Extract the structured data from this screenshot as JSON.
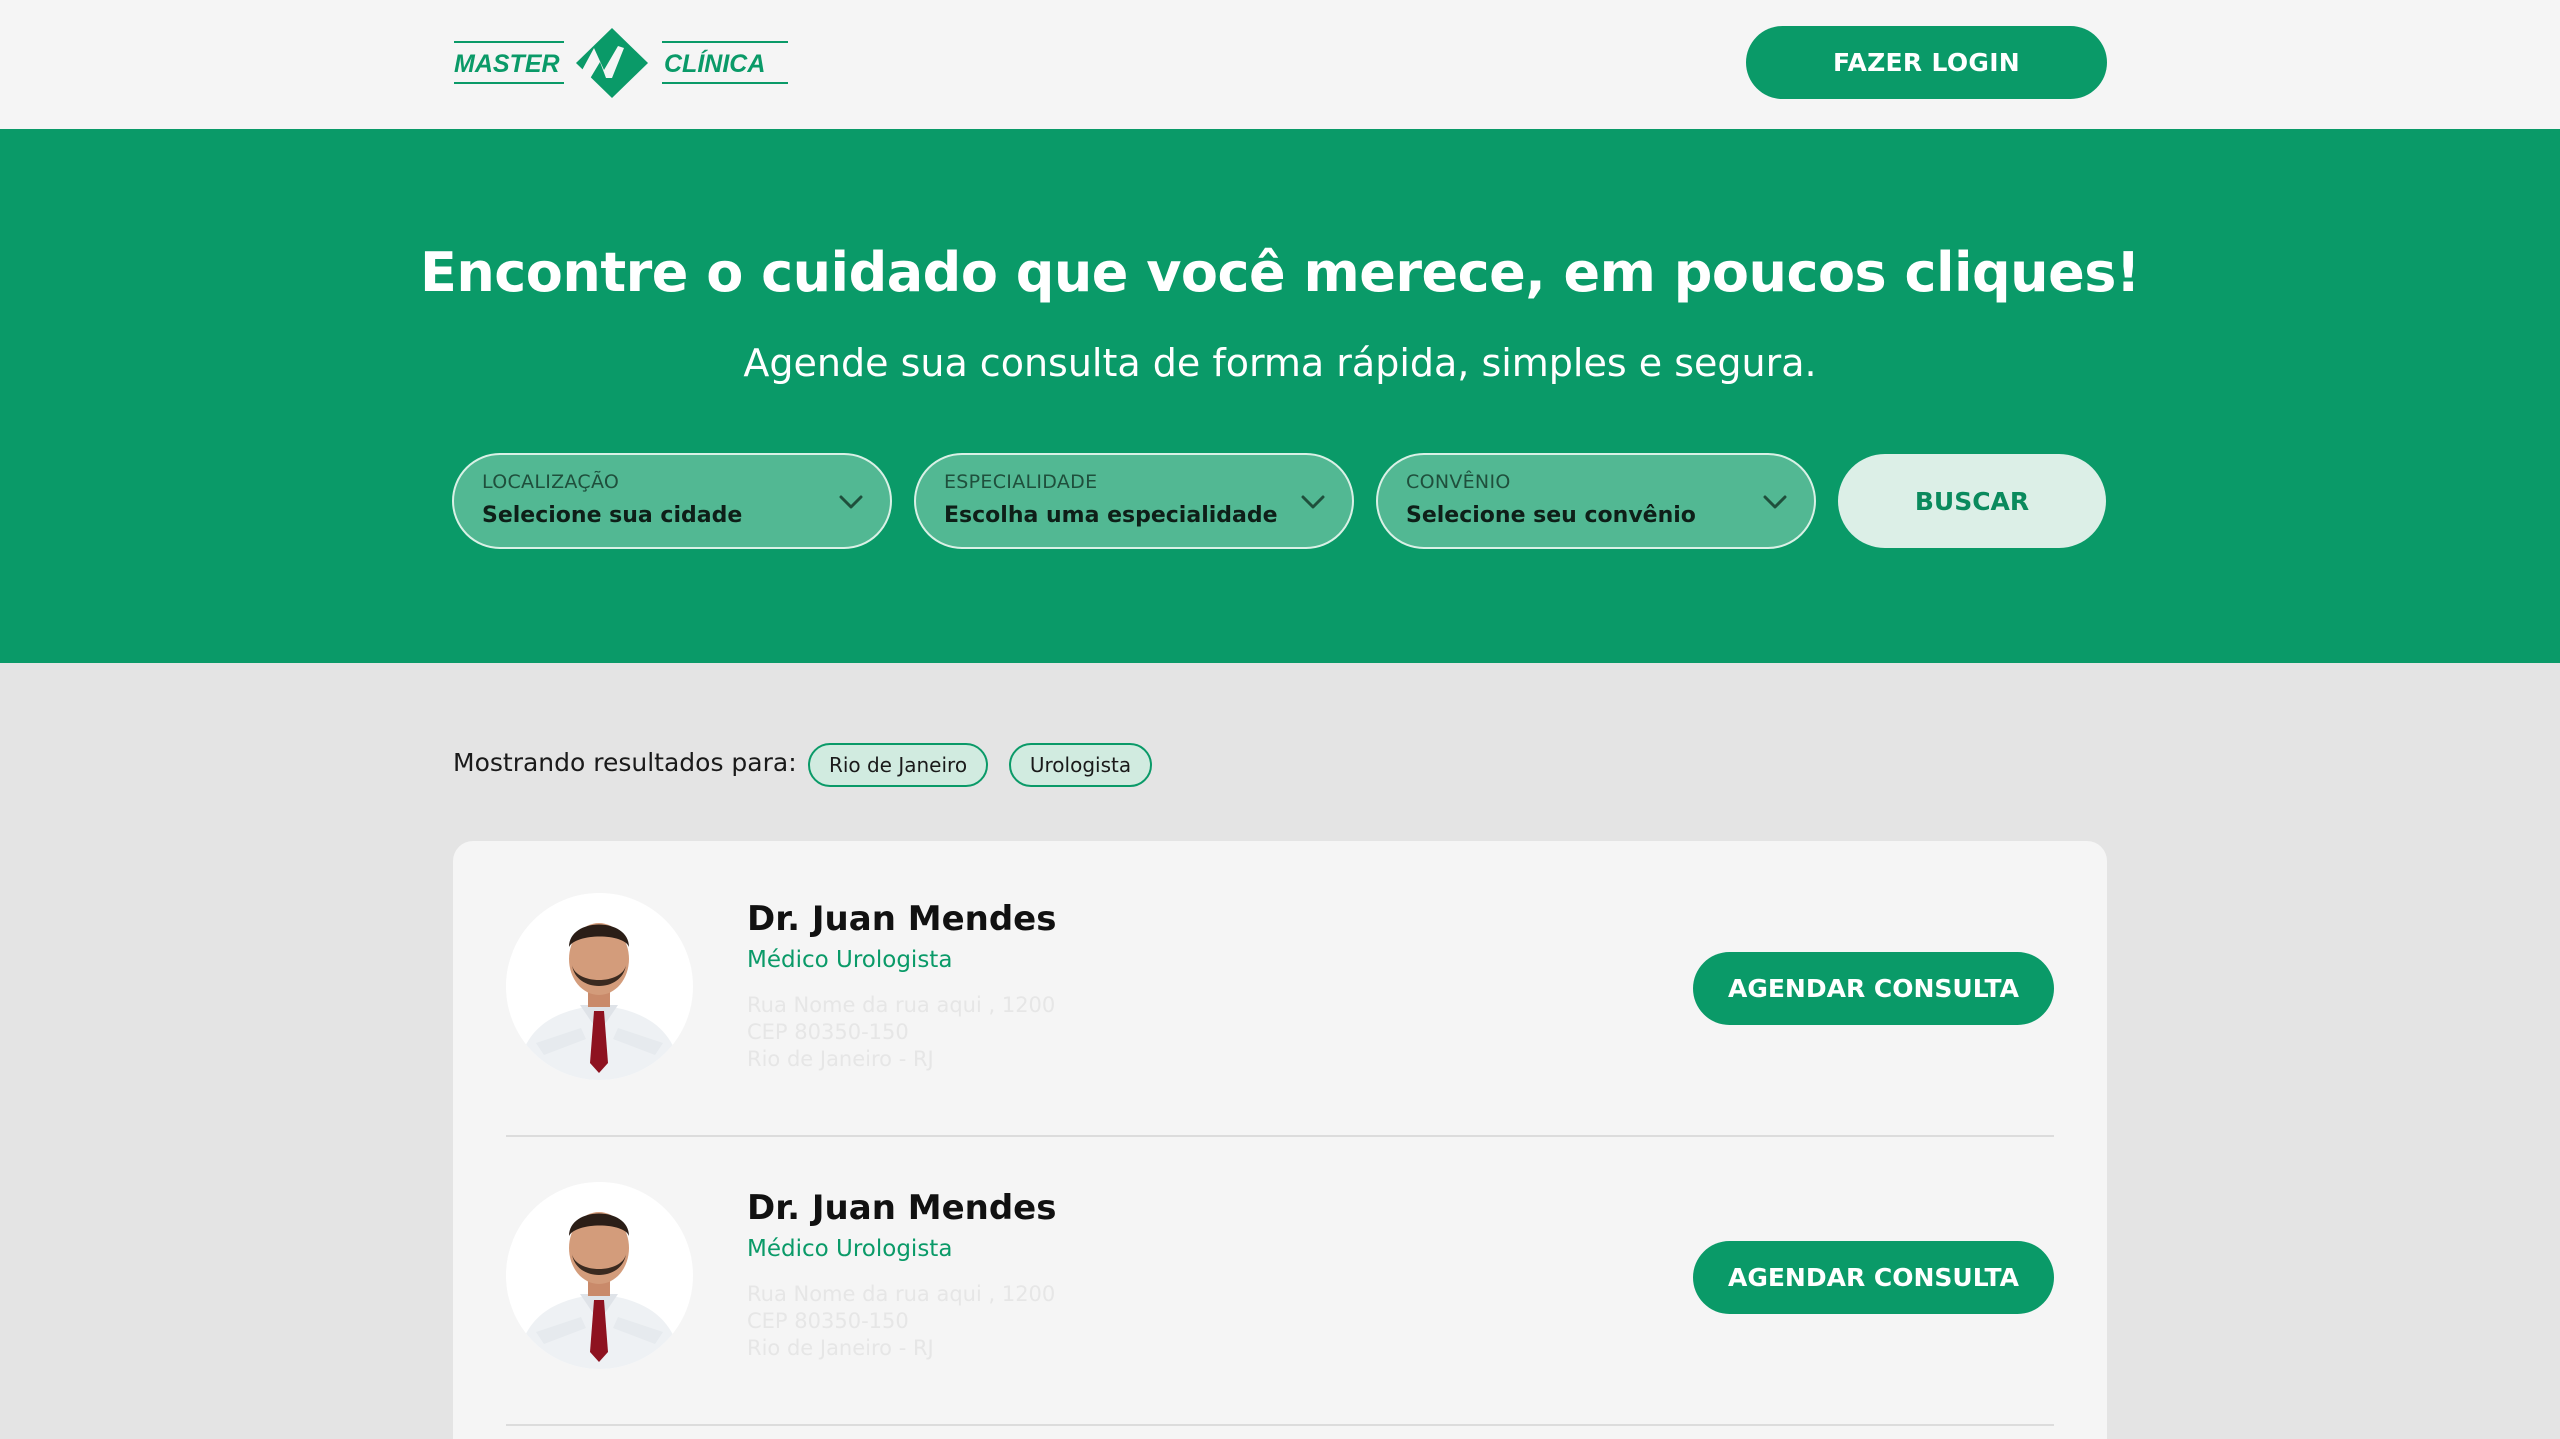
{
  "brand": {
    "logo_text_left": "MASTER",
    "logo_text_right": "CLÍNICA",
    "primary_color": "#0a9a68",
    "light_accent": "#dcefe7"
  },
  "header": {
    "login_label": "FAZER LOGIN"
  },
  "hero": {
    "title": "Encontre o cuidado que você merece, em poucos cliques!",
    "subtitle": "Agende sua consulta de forma rápida, simples e segura.",
    "filters": [
      {
        "label": "LOCALIZAÇÃO",
        "value": "Selecione sua cidade",
        "icon": "chevron-down-icon"
      },
      {
        "label": "ESPECIALIDADE",
        "value": "Escolha uma especialidade",
        "icon": "chevron-down-icon"
      },
      {
        "label": "CONVÊNIO",
        "value": "Selecione seu convênio",
        "icon": "chevron-down-icon"
      }
    ],
    "search_label": "BUSCAR"
  },
  "results": {
    "label": "Mostrando resultados para:",
    "chips": [
      "Rio de Janeiro",
      "Urologista"
    ],
    "doctors": [
      {
        "name": "Dr. Juan Mendes",
        "specialty": "Médico Urologista",
        "address_line1": "Rua Nome da rua aqui , 1200",
        "address_line2": "CEP 80350-150",
        "address_line3": "Rio de Janeiro - RJ",
        "button_label": "AGENDAR CONSULTA"
      },
      {
        "name": "Dr. Juan Mendes",
        "specialty": "Médico Urologista",
        "address_line1": "Rua Nome da rua aqui , 1200",
        "address_line2": "CEP 80350-150",
        "address_line3": "Rio de Janeiro - RJ",
        "button_label": "AGENDAR CONSULTA"
      }
    ]
  }
}
